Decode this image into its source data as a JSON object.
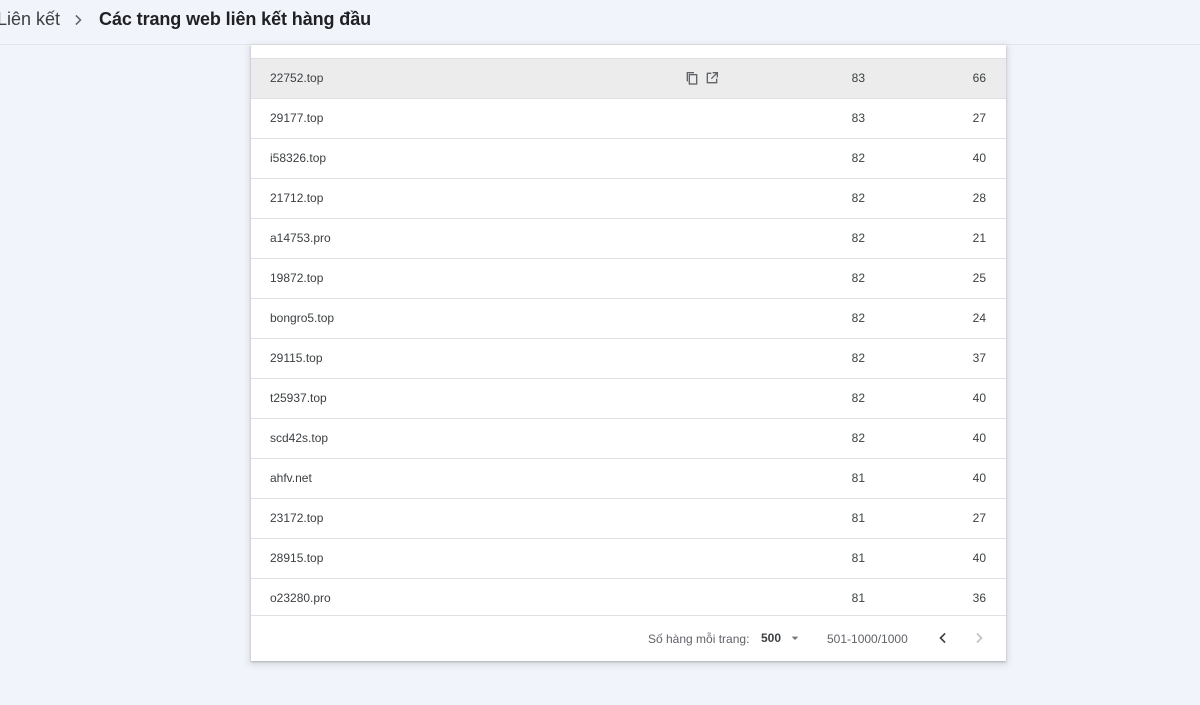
{
  "breadcrumb": {
    "parent": "Liên kết",
    "current": "Các trang web liên kết hàng đầu"
  },
  "table": {
    "rows": [
      {
        "domain": "22752.top",
        "linked_pages": "83",
        "linking_sites": "66"
      },
      {
        "domain": "29177.top",
        "linked_pages": "83",
        "linking_sites": "27"
      },
      {
        "domain": "i58326.top",
        "linked_pages": "82",
        "linking_sites": "40"
      },
      {
        "domain": "21712.top",
        "linked_pages": "82",
        "linking_sites": "28"
      },
      {
        "domain": "a14753.pro",
        "linked_pages": "82",
        "linking_sites": "21"
      },
      {
        "domain": "19872.top",
        "linked_pages": "82",
        "linking_sites": "25"
      },
      {
        "domain": "bongro5.top",
        "linked_pages": "82",
        "linking_sites": "24"
      },
      {
        "domain": "29115.top",
        "linked_pages": "82",
        "linking_sites": "37"
      },
      {
        "domain": "t25937.top",
        "linked_pages": "82",
        "linking_sites": "40"
      },
      {
        "domain": "scd42s.top",
        "linked_pages": "82",
        "linking_sites": "40"
      },
      {
        "domain": "ahfv.net",
        "linked_pages": "81",
        "linking_sites": "40"
      },
      {
        "domain": "23172.top",
        "linked_pages": "81",
        "linking_sites": "27"
      },
      {
        "domain": "28915.top",
        "linked_pages": "81",
        "linking_sites": "40"
      },
      {
        "domain": "o23280.pro",
        "linked_pages": "81",
        "linking_sites": "36"
      }
    ],
    "hovered_row_index": 0,
    "row_action_icons": [
      "copy-icon",
      "open-in-new-icon"
    ]
  },
  "pagination": {
    "rows_per_page_label": "Số hàng mỗi trang:",
    "rows_per_page_value": "500",
    "range": "501-1000/1000",
    "prev_icon": "chevron-left-icon",
    "next_icon": "chevron-right-icon",
    "next_disabled": true
  },
  "colors": {
    "page_background": "#f1f4fa",
    "card_background": "#ffffff",
    "hover_row": "#ececec",
    "divider": "#e0e0e0",
    "text_primary": "#202124",
    "text_secondary": "#5f6368"
  }
}
